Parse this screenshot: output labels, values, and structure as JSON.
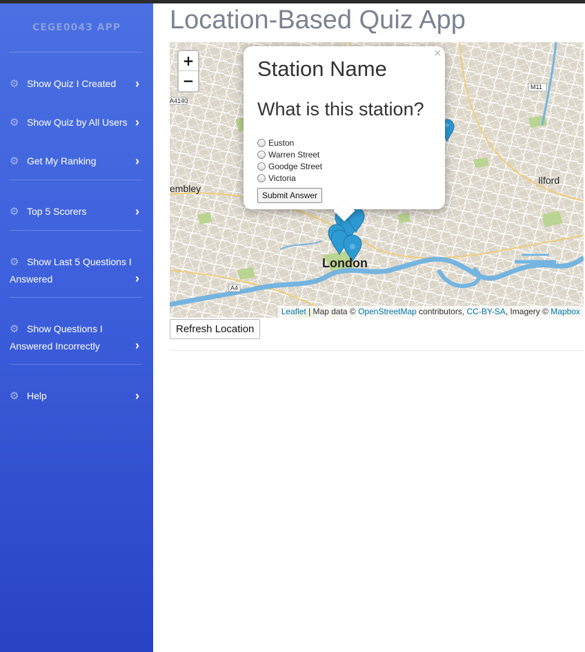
{
  "app": {
    "brand": "CEGE0043 APP",
    "title": "Location-Based Quiz App"
  },
  "sidebar": {
    "items": [
      {
        "label": "Show Quiz I Created",
        "icon": "gear-icon"
      },
      {
        "label": "Show Quiz by All Users",
        "icon": "gear-icon"
      },
      {
        "label": "Get My Ranking",
        "icon": "gear-icon"
      },
      {
        "label": "Top 5 Scorers",
        "icon": "gear-icon"
      },
      {
        "label": "Show Last 5 Questions I",
        "label2": "Answered",
        "icon": "gear-icon"
      },
      {
        "label": "Show Questions I",
        "label2": "Answered Incorrectly",
        "icon": "gear-icon"
      },
      {
        "label": "Help",
        "icon": "gear-icon"
      }
    ]
  },
  "map": {
    "zoom_in": "+",
    "zoom_out": "−",
    "labels": {
      "london": "London",
      "wembley": "embley",
      "ilford": "Ilford",
      "m11": "M11",
      "a4140": "A4140",
      "a4": "A4"
    },
    "attribution": {
      "leaflet": "Leaflet",
      "mapdata": " | Map data © ",
      "osm": "OpenStreetMap",
      "contributors": " contributors, ",
      "ccbysa": "CC-BY-SA",
      "imagery": ", Imagery © ",
      "mapbox": "Mapbox"
    },
    "popup": {
      "close": "×",
      "title": "Station Name",
      "question": "What is this station?",
      "options": [
        "Euston",
        "Warren Street",
        "Goodge Street",
        "Victoria"
      ],
      "submit": "Submit Answer"
    },
    "colors": {
      "marker": "#2e9ad4",
      "water": "#74b4e0",
      "park": "#b5d38a",
      "land": "#dcd6c9"
    }
  },
  "refresh_button": "Refresh Location"
}
